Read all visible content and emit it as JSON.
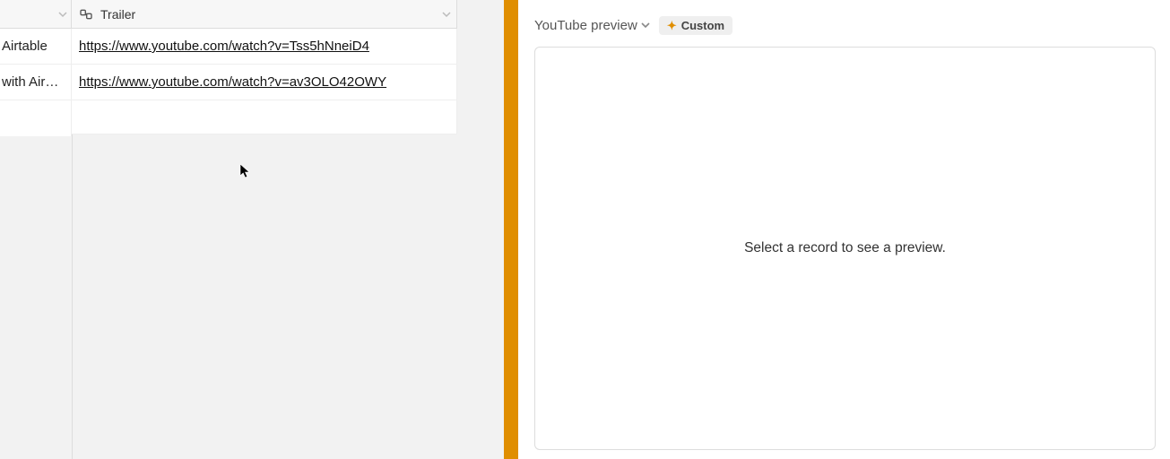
{
  "grid": {
    "columns": {
      "trailer_header": "Trailer"
    },
    "rows": [
      {
        "left": "Airtable",
        "trailer": "https://www.youtube.com/watch?v=Tss5hNneiD4"
      },
      {
        "left": "with Air…",
        "trailer": "https://www.youtube.com/watch?v=av3OLO42OWY"
      }
    ]
  },
  "rightPane": {
    "title": "YouTube preview",
    "badge": "Custom",
    "placeholder": "Select a record to see a preview."
  }
}
